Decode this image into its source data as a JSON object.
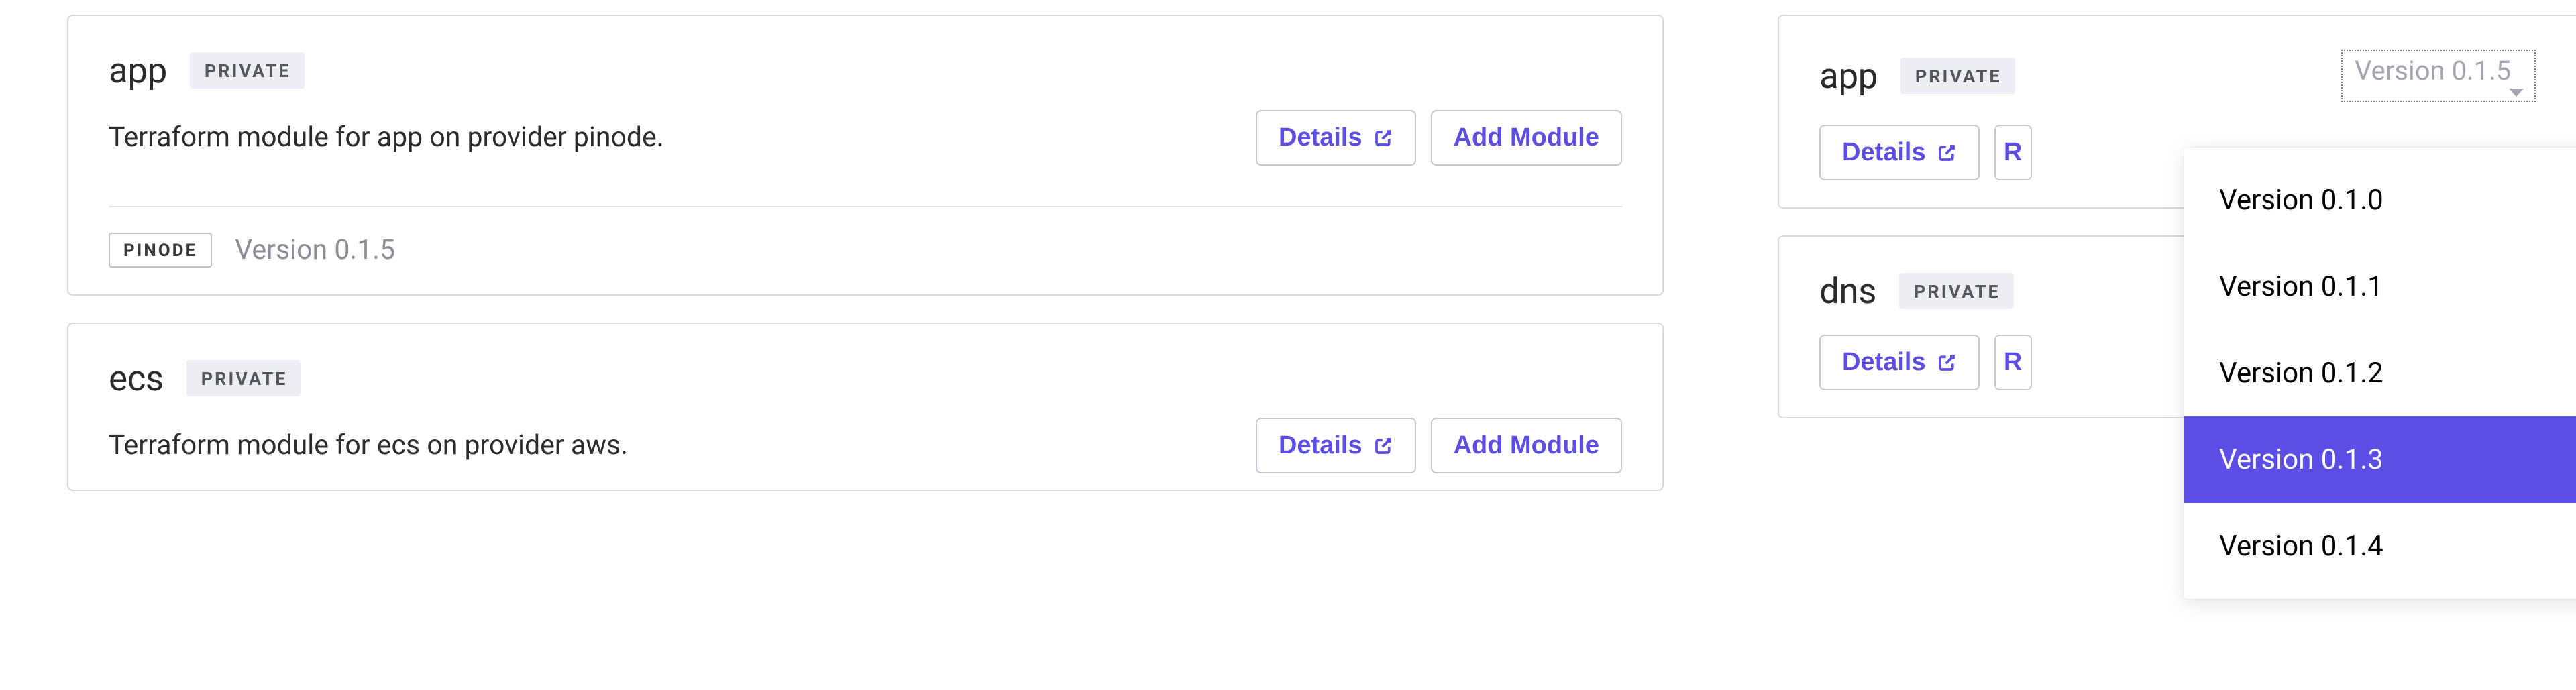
{
  "labels": {
    "private": "PRIVATE",
    "details": "Details",
    "add_module": "Add Module"
  },
  "left": {
    "cards": [
      {
        "name": "app",
        "desc": "Terraform module for app on provider pinode.",
        "provider": "PINODE",
        "version": "Version 0.1.5"
      },
      {
        "name": "ecs",
        "desc": "Terraform module for ecs on provider aws."
      }
    ]
  },
  "right": {
    "cards": [
      {
        "name": "app",
        "version_select": "Version 0.1.5",
        "trunc_btn": "R"
      },
      {
        "name": "dns",
        "trunc_btn": "R"
      }
    ]
  },
  "dropdown": {
    "options": [
      "Version 0.1.0",
      "Version 0.1.1",
      "Version 0.1.2",
      "Version 0.1.3",
      "Version 0.1.4"
    ],
    "active_index": 3
  }
}
